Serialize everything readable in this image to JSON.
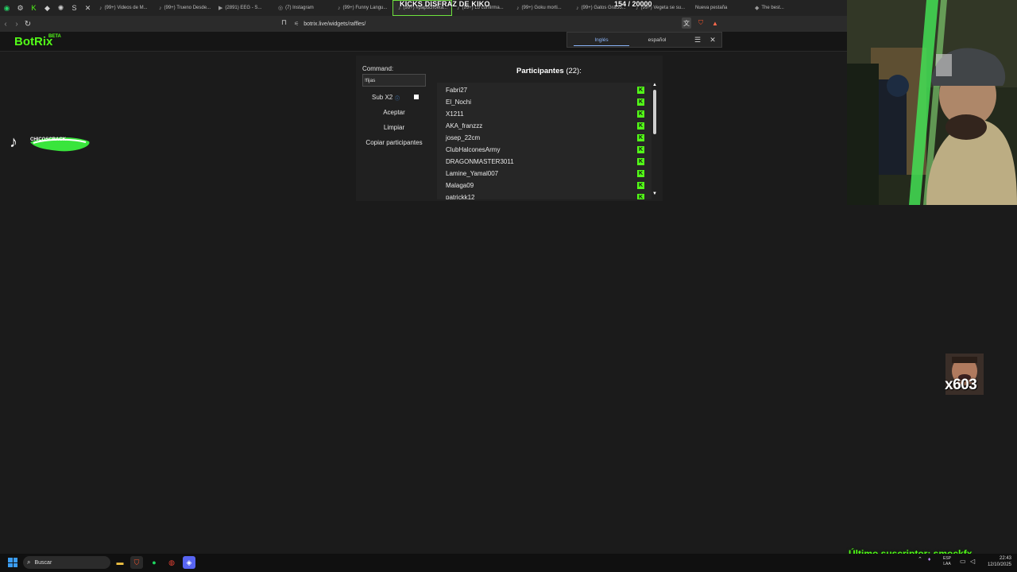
{
  "browser": {
    "pinned": [
      {
        "icon": "whatsapp-icon",
        "glyph": "◉",
        "color": "#25d366"
      },
      {
        "icon": "settings-icon",
        "glyph": "⚙",
        "color": "#cfcfcf"
      },
      {
        "icon": "kick-icon",
        "glyph": "K",
        "color": "#53fc18"
      },
      {
        "icon": "diamond-icon",
        "glyph": "◆",
        "color": "#cfcfcf"
      },
      {
        "icon": "chatgpt-icon",
        "glyph": "✺",
        "color": "#cfcfcf"
      },
      {
        "icon": "s-icon",
        "glyph": "S",
        "color": "#cfcfcf"
      },
      {
        "icon": "muted-icon",
        "glyph": "✕",
        "color": "#cfcfcf"
      }
    ],
    "tabs": [
      {
        "label": "(99+) Videos de M...",
        "icon": "♪"
      },
      {
        "label": "(99+) Trueno Desde...",
        "icon": "♪"
      },
      {
        "label": "(2891) EEG - S...",
        "icon": "▶"
      },
      {
        "label": "(7) Instagram",
        "icon": "◎"
      },
      {
        "label": "(99+) Funny Langu...",
        "icon": "♪"
      },
      {
        "label": "(99+) #papuchoeta...",
        "icon": "♪",
        "active": true
      },
      {
        "label": "(99+) Lo confirma...",
        "icon": "♪"
      },
      {
        "label": "(99+) Goku morti...",
        "icon": "♪"
      },
      {
        "label": "(99+) Gatos Gracio...",
        "icon": "♪"
      },
      {
        "label": "(99+) Vegeta se su...",
        "icon": "♪"
      },
      {
        "label": "Nueva pestaña",
        "icon": ""
      },
      {
        "label": "The best...",
        "icon": "◆"
      }
    ],
    "url": "botrix.live/widgets/raffles/"
  },
  "stream_overlay": {
    "title": "KICKS DISFRAZ DE KIKO",
    "counter": "154 / 20000",
    "tiktok_text": "CHICOSCRACK",
    "avatar_number": "x603",
    "last_subscriber": "Último suscriptor: smockfx"
  },
  "translate_popup": {
    "lang_source": "Inglés",
    "lang_target": "español"
  },
  "app": {
    "logo": "BotRix",
    "logo_badge": "BETA"
  },
  "raffle": {
    "command_label": "Command:",
    "command_value": "!fijas",
    "sub_label": "Sub X2",
    "accept_label": "Aceptar",
    "clear_label": "Limpiar",
    "copy_label": "Copiar participantes",
    "participants_label": "Participantes",
    "participants_count": "(22):",
    "participants": [
      "Fabri27",
      "El_Nochi",
      "X1211",
      "AKA_franzzz",
      "josep_22cm",
      "ClubHalconesArmy",
      "DRAGONMASTER3011",
      "Lamine_Yamal007",
      "Malaga09",
      "patrickk12"
    ]
  },
  "taskbar": {
    "search_placeholder": "Buscar",
    "tray_lang_1": "ESP",
    "tray_lang_2": "LAA",
    "time": "22:43",
    "date": "12/10/2025"
  },
  "colors": {
    "accent": "#53fc18",
    "background": "#1b1b1b",
    "panel": "#202020"
  }
}
